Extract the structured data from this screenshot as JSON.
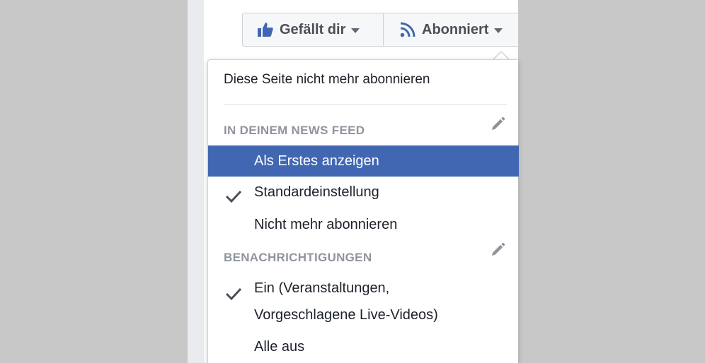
{
  "toolbar": {
    "like_label": "Gefällt dir",
    "follow_label": "Abonniert"
  },
  "menu": {
    "unfollow_page": "Diese Seite nicht mehr abonnieren",
    "news_feed": {
      "heading": "IN DEINEM NEWS FEED",
      "items": [
        {
          "label": "Als Erstes anzeigen",
          "selected": true,
          "checked": false
        },
        {
          "label": "Standardeinstellung",
          "selected": false,
          "checked": true
        },
        {
          "label": "Nicht mehr abonnieren",
          "selected": false,
          "checked": false
        }
      ]
    },
    "notifications": {
      "heading": "BENACHRICHTIGUNGEN",
      "items": [
        {
          "label_line1": "Ein (Veranstaltungen,",
          "label_line2": "Vorgeschlagene Live-Videos)",
          "checked": true
        },
        {
          "label": "Alle aus",
          "checked": false
        }
      ]
    }
  },
  "colors": {
    "accent": "#4267b2",
    "icon_blue": "#4267b2",
    "heading_gray": "#90949c",
    "text": "#1d2129"
  },
  "icons": {
    "like": "thumbs-up-icon",
    "follow": "rss-icon",
    "edit": "pencil-icon",
    "check": "checkmark-icon"
  }
}
